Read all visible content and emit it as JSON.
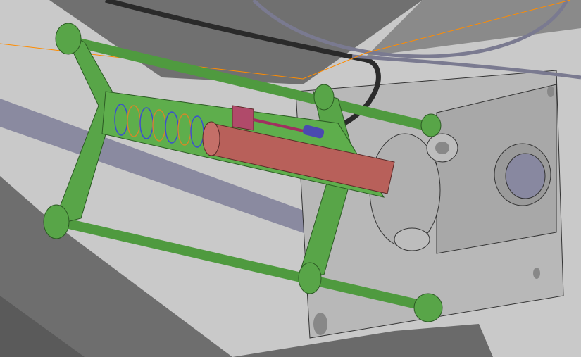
{
  "viewport": {
    "type": "cad-3d-view",
    "colors": {
      "background": "#c9c9c9",
      "frame_green": "#4f9a3f",
      "cylinder_red": "#b8605a",
      "spring_blue": "#3a4fd0",
      "spring_orange": "#d08a2a",
      "housing_gray": "#b4b4b4",
      "cable_dark": "#2a2a2a",
      "sketch_orange": "#ff8c00"
    }
  }
}
